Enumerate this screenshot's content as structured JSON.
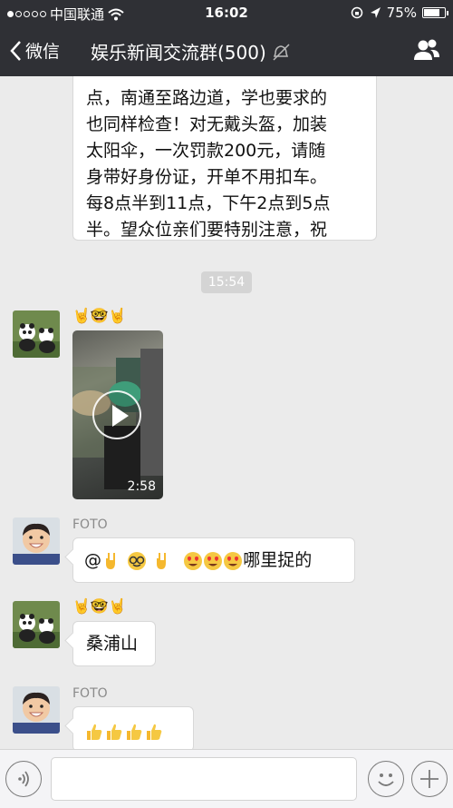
{
  "status_bar": {
    "carrier": "中国联通",
    "time": "16:02",
    "battery": "75%",
    "signal_bars": 1,
    "battery_level": 0.75
  },
  "nav": {
    "back_label": "微信",
    "title": "娱乐新闻交流群(500)"
  },
  "messages": [
    {
      "type": "text",
      "text": "点，南通至路边道，学也要求的\n也同样检查！对无戴头盔，加装\n太阳伞，一次罚款200元，请随\n身带好身份证，开单不用扣车。\n每8点半到11点，下午2点到5点\n半。望众位亲们要特别注意，祝\n大家平安顺利！"
    },
    {
      "type": "time",
      "text": "15:54"
    },
    {
      "type": "video",
      "sender_display": "🤘🤓🤘",
      "duration": "2:58"
    },
    {
      "type": "text",
      "sender": "FOTO",
      "text_prefix": "@",
      "text_suffix": "哪里捉的"
    },
    {
      "type": "text",
      "sender_display": "🤘🤓🤘",
      "text": "桑浦山"
    },
    {
      "type": "text",
      "sender": "FOTO",
      "text": "👍👍👍👍"
    }
  ],
  "icons": {
    "back": "chevron-left-icon",
    "mute": "mute-icon",
    "group": "group-members-icon",
    "voice": "voice-icon",
    "emoji": "emoji-icon",
    "plus": "plus-icon"
  },
  "colors": {
    "nav_bg": "#2f3035",
    "chat_bg": "#ebebeb",
    "bubble_bg": "#ffffff"
  }
}
